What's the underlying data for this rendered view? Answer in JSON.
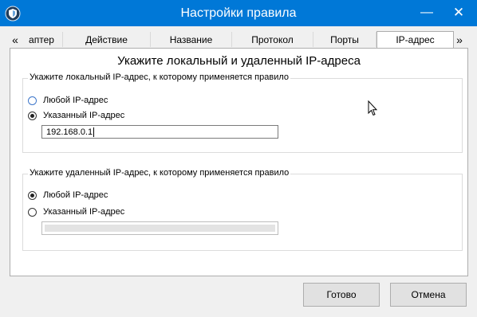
{
  "window": {
    "title": "Настройки правила",
    "minimize_glyph": "—",
    "close_glyph": "✕"
  },
  "tabs": {
    "scroll_left_glyph": "«",
    "scroll_right_glyph": "»",
    "items": [
      {
        "label": "аптер"
      },
      {
        "label": "Действие"
      },
      {
        "label": "Название"
      },
      {
        "label": "Протокол"
      },
      {
        "label": "Порты"
      },
      {
        "label": "IP-адрес",
        "active": true
      }
    ]
  },
  "panel": {
    "heading": "Укажите локальный и удаленный IP-адреса",
    "local": {
      "legend": "Укажите локальный IP-адрес, к которому применяется правило",
      "option_any": "Любой IP-адрес",
      "option_specific": "Указанный IP-адрес",
      "selected": "specific",
      "value": "192.168.0.1"
    },
    "remote": {
      "legend": "Укажите удаленный IP-адрес, к которому применяется правило",
      "option_any": "Любой IP-адрес",
      "option_specific": "Указанный IP-адрес",
      "selected": "any",
      "value": ""
    }
  },
  "buttons": {
    "ok": "Готово",
    "cancel": "Отмена"
  },
  "colors": {
    "titlebar": "#0078d7",
    "radio_accent": "#3a74c9"
  },
  "icons": {
    "app": "shield-icon",
    "pointer": "mouse-cursor-icon"
  }
}
